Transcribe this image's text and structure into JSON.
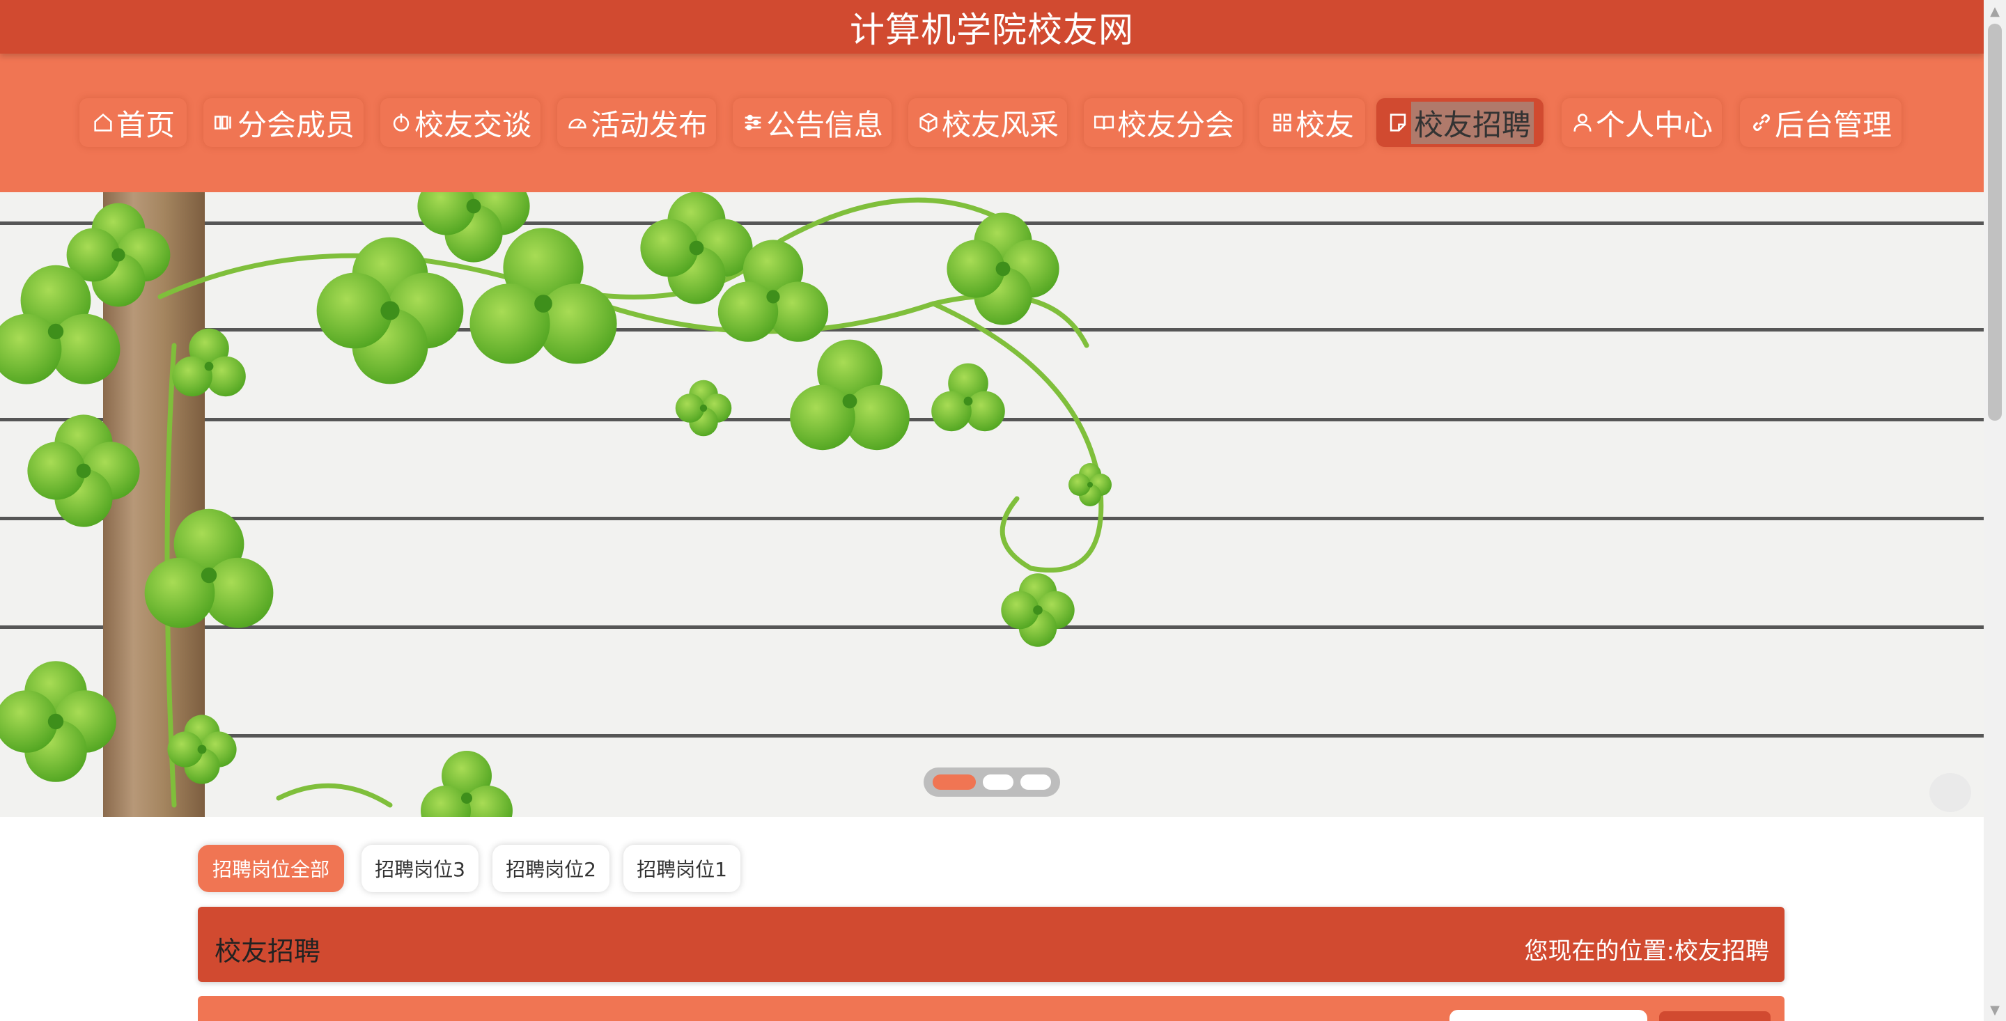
{
  "header": {
    "title": "计算机学院校友网"
  },
  "nav": {
    "items": [
      {
        "label": "首页",
        "icon": "home-icon"
      },
      {
        "label": "分会成员",
        "icon": "members-icon"
      },
      {
        "label": "校友交谈",
        "icon": "power-icon"
      },
      {
        "label": "活动发布",
        "icon": "gauge-icon"
      },
      {
        "label": "公告信息",
        "icon": "sliders-icon"
      },
      {
        "label": "校友风采",
        "icon": "cube-icon"
      },
      {
        "label": "校友分会",
        "icon": "book-icon"
      },
      {
        "label": "校友",
        "icon": "grid-icon"
      },
      {
        "label": "校友招聘",
        "icon": "note-icon",
        "active": true
      },
      {
        "label": "个人中心",
        "icon": "user-icon"
      },
      {
        "label": "后台管理",
        "icon": "link-icon"
      }
    ]
  },
  "banner": {
    "slides": 3,
    "active_slide": 1
  },
  "categories": [
    {
      "label": "招聘岗位全部",
      "active": true
    },
    {
      "label": "招聘岗位3"
    },
    {
      "label": "招聘岗位2"
    },
    {
      "label": "招聘岗位1"
    }
  ],
  "section": {
    "title": "校友招聘",
    "breadcrumb_prefix": "您现在的位置:",
    "breadcrumb_current": "校友招聘"
  },
  "colors": {
    "primary": "#d14a30",
    "accent": "#f07553",
    "text": "#333333"
  }
}
